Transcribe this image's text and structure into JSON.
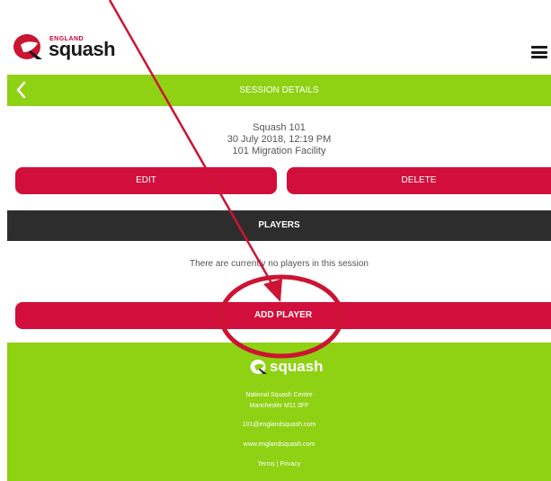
{
  "header": {
    "brand_small": "ENGLAND",
    "brand": "squash",
    "menu_icon": "hamburger-menu-icon"
  },
  "topbar": {
    "title": "SESSION DETAILS",
    "back_icon": "chevron-left-icon"
  },
  "session": {
    "name": "Squash 101",
    "datetime": "30 July 2018, 12:19 PM",
    "location": "101 Migration Facility"
  },
  "actions": {
    "edit_label": "EDIT",
    "delete_label": "DELETE"
  },
  "players": {
    "header": "PLAYERS",
    "empty_message": "There are currently no players in this session",
    "add_label": "ADD PLAYER"
  },
  "footer": {
    "brand": "squash",
    "address_line1": "National Squash Centre",
    "address_line2": "Manchester M11 3FF",
    "email": "101@englandsquash.com",
    "website": "www.englandsquash.com",
    "terms": "Terms",
    "separator": "|",
    "privacy": "Privacy"
  },
  "colors": {
    "brand_green": "#8fd113",
    "brand_red": "#d20f3c",
    "dark_bar": "#2d2d2d",
    "annotation": "#cc1433"
  }
}
